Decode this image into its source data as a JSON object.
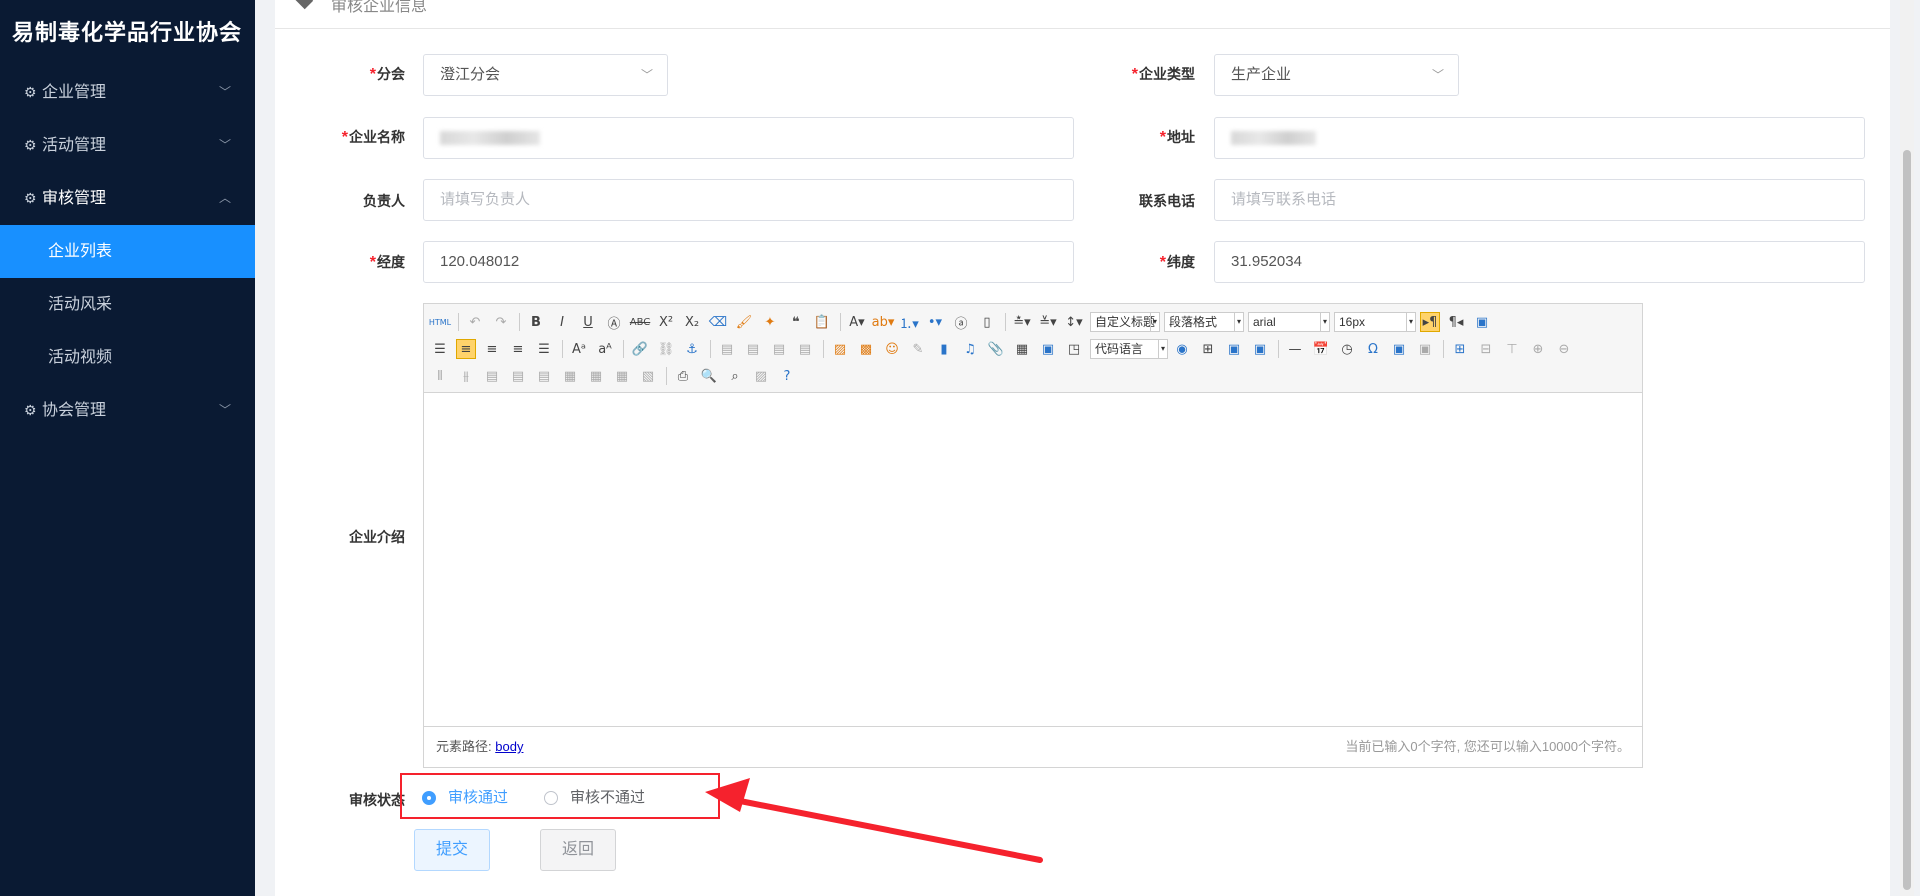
{
  "sidebar": {
    "brand": "易制毒化学品行业协会",
    "menus": [
      {
        "label": "企业管理",
        "chevron": "chevron-down"
      },
      {
        "label": "活动管理",
        "chevron": "chevron-down"
      },
      {
        "label": "审核管理",
        "chevron": "chevron-up"
      }
    ],
    "sub_items": [
      "企业列表",
      "活动风采",
      "活动视频"
    ],
    "last_menu": {
      "label": "协会管理",
      "chevron": "chevron-down"
    }
  },
  "header": {
    "title": "审核企业信息"
  },
  "form": {
    "branch": {
      "label": "分会",
      "value": "澄江分会"
    },
    "company_type": {
      "label": "企业类型",
      "value": "生产企业"
    },
    "company_name": {
      "label": "企业名称"
    },
    "address": {
      "label": "地址"
    },
    "owner": {
      "label": "负责人",
      "placeholder": "请填写负责人"
    },
    "phone": {
      "label": "联系电话",
      "placeholder": "请填写联系电话"
    },
    "longitude": {
      "label": "经度",
      "value": "120.048012"
    },
    "latitude": {
      "label": "纬度",
      "value": "31.952034"
    },
    "intro": {
      "label": "企业介绍"
    },
    "review_status": {
      "label": "审核状态"
    }
  },
  "editor": {
    "combos": {
      "custom_title": "自定义标题",
      "paragraph": "段落格式",
      "font": "arial",
      "size": "16px",
      "code_lang": "代码语言"
    },
    "path_label": "元素路径:",
    "path_link": "body",
    "char_count": "当前已输入0个字符, 您还可以输入10000个字符。"
  },
  "review": {
    "options": [
      {
        "label": "审核通过",
        "checked": true
      },
      {
        "label": "审核不通过",
        "checked": false
      }
    ]
  },
  "buttons": {
    "submit": "提交",
    "back": "返回"
  },
  "colors": {
    "accent": "#1890ff",
    "required": "#f5222d",
    "highlight_box": "#f5222d",
    "sidebar_bg": "#0a1a33"
  }
}
